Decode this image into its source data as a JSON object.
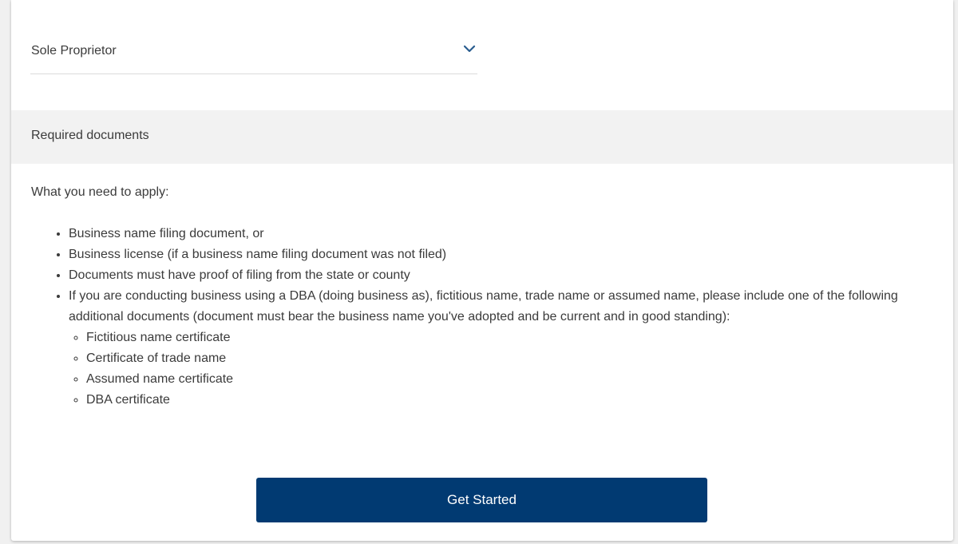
{
  "business_type_select": {
    "value": "Sole Proprietor",
    "icon": "chevron-down-icon"
  },
  "required_section": {
    "title": "Required documents",
    "intro": "What you need to apply:",
    "items": [
      "Business name filing document, or",
      "Business license (if a business name filing document was not filed)",
      "Documents must have proof of filing from the state or county",
      "If you are conducting business using a DBA (doing business as), fictitious name, trade name or assumed name, please include one of the following additional documents (document must bear the business name you've adopted and be current and in good standing):"
    ],
    "sub_items": [
      "Fictitious name certificate",
      "Certificate of trade name",
      "Assumed name certificate",
      "DBA certificate"
    ]
  },
  "cta": {
    "label": "Get Started"
  },
  "colors": {
    "primary_button": "#013a72",
    "chevron": "#2a5d8f",
    "section_header_bg": "#f2f2f2",
    "text": "#3b3b3b"
  }
}
